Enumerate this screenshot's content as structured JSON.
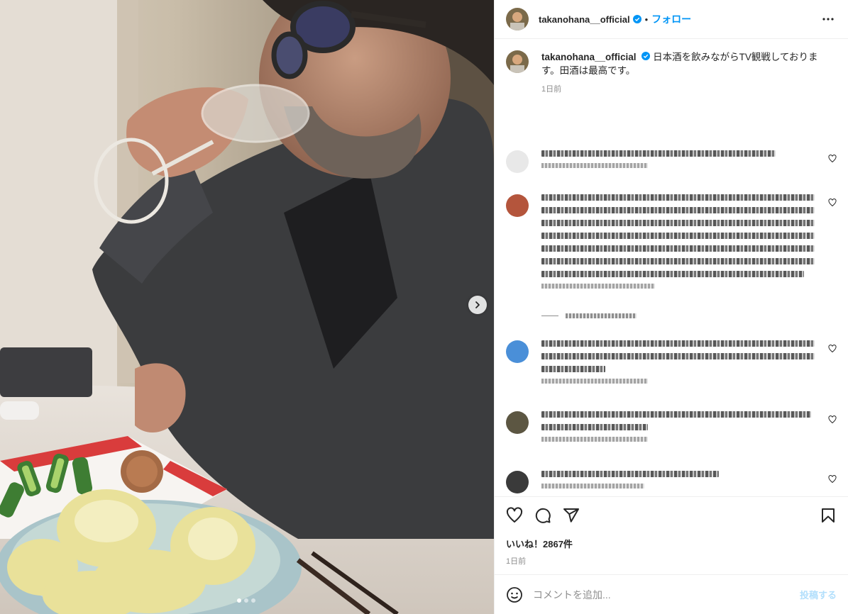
{
  "post": {
    "username": "takanohana__official",
    "separator": "•",
    "follow_label": "フォロー",
    "caption_text": "日本酒を飲みながらTV観戦しております。田酒は最高です。",
    "caption_time": "1日前",
    "likes_text": "いいね！2867件",
    "post_time": "1日前",
    "comment_placeholder": "コメントを追加...",
    "post_button": "投稿する"
  },
  "colors": {
    "link": "#0095f6",
    "muted": "#8e8e8e",
    "border": "#efefef"
  },
  "icons": [
    "verified-badge-icon",
    "more-options-icon",
    "heart-icon",
    "comment-icon",
    "share-icon",
    "bookmark-icon",
    "emoji-icon",
    "chevron-right-icon"
  ],
  "carousel": {
    "slides": 3,
    "active": 1
  }
}
